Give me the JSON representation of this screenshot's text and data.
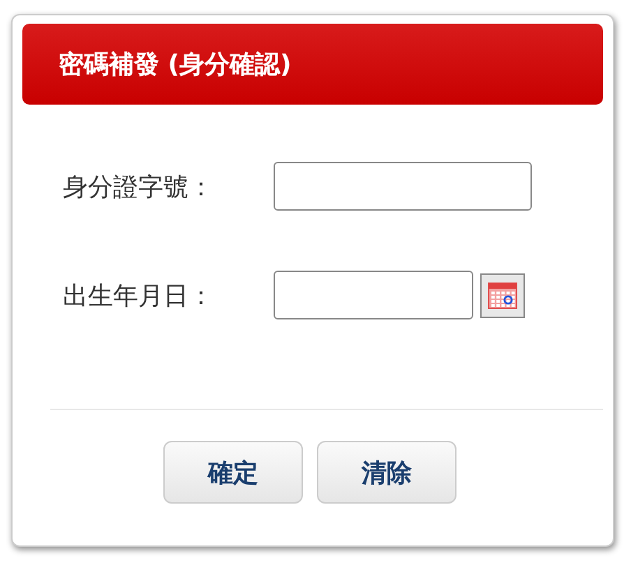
{
  "dialog": {
    "title": "密碼補發 (身分確認)"
  },
  "fields": [
    {
      "label": "身分證字號：",
      "kind": "text"
    },
    {
      "label": "出生年月日：",
      "kind": "date"
    }
  ],
  "buttons": [
    "確定",
    "清除"
  ]
}
